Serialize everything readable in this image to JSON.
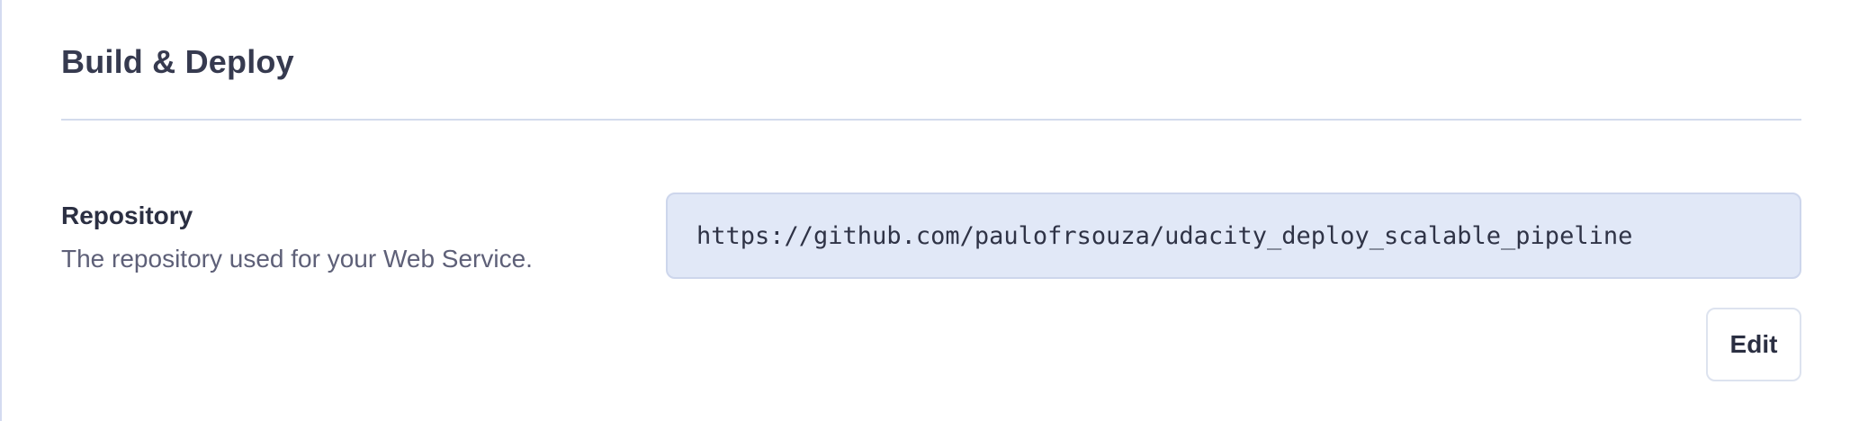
{
  "section": {
    "title": "Build & Deploy"
  },
  "repository": {
    "label": "Repository",
    "description": "The repository used for your Web Service.",
    "url": "https://github.com/paulofrsouza/udacity_deploy_scalable_pipeline"
  },
  "actions": {
    "edit_label": "Edit"
  },
  "colors": {
    "title_text": "#363a4f",
    "body_text": "#5e6078",
    "repo_box_bg": "#e1e8f7",
    "divider": "#d3dbec"
  }
}
